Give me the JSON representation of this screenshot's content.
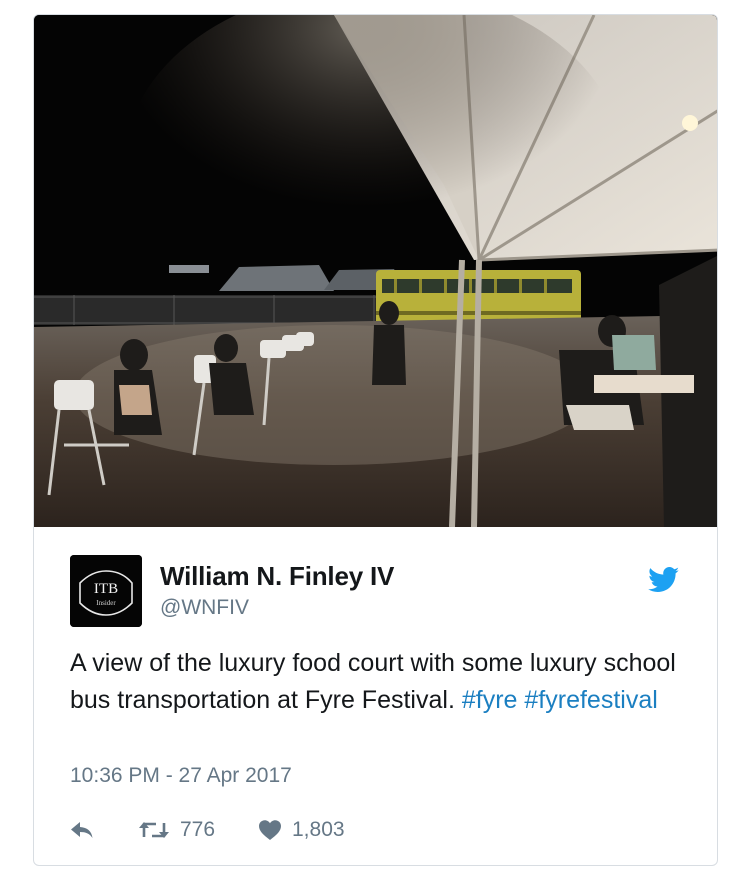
{
  "tweet": {
    "author_name": "William N. Finley IV",
    "author_handle": "@WNFIV",
    "avatar": {
      "line1": "ITB",
      "line2": "Insider"
    },
    "text_plain": "A view of the luxury food court with some luxury school bus transportation at Fyre Festival.",
    "hashtags": [
      "#fyre",
      "#fyrefestival"
    ],
    "timestamp": "10:36 PM - 27 Apr 2017",
    "retweets": "776",
    "likes": "1,803"
  },
  "icons": {
    "reply": "reply-icon",
    "retweet": "retweet-icon",
    "like": "heart-icon",
    "brand": "twitter-bird-icon"
  },
  "colors": {
    "link": "#1b7fc1",
    "twitter_blue": "#1da1f2",
    "muted": "#657786",
    "border": "#d8dde2",
    "bus_yellow": "#b8b13a"
  }
}
